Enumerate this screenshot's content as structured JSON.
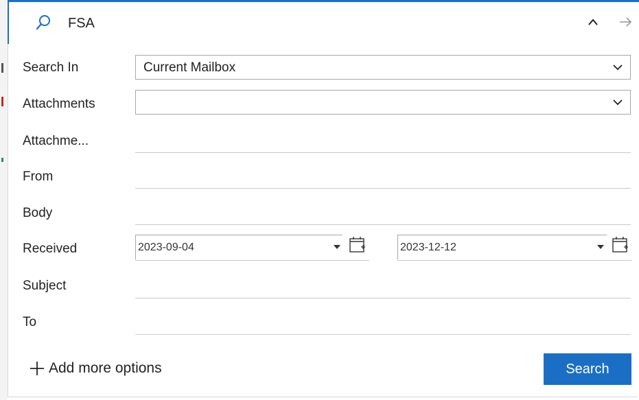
{
  "search": {
    "query": "FSA"
  },
  "fields": {
    "search_in": {
      "label": "Search In",
      "value": "Current Mailbox"
    },
    "attachments": {
      "label": "Attachments",
      "value": ""
    },
    "attachment_name": {
      "label": "Attachme...",
      "value": ""
    },
    "from": {
      "label": "From",
      "value": ""
    },
    "body": {
      "label": "Body",
      "value": ""
    },
    "received": {
      "label": "Received",
      "start": "2023-09-04",
      "end": "2023-12-12"
    },
    "subject": {
      "label": "Subject",
      "value": ""
    },
    "to": {
      "label": "To",
      "value": ""
    }
  },
  "footer": {
    "add_more": "Add more options",
    "search_button": "Search"
  },
  "colors": {
    "accent": "#1a6fc5",
    "edge_marks": [
      "#555555",
      "#c42b1c",
      "#2e8b57"
    ]
  },
  "icons": [
    "search-icon",
    "chevron-up-icon",
    "arrow-right-icon",
    "chevron-down-icon",
    "calendar-icon",
    "plus-icon"
  ]
}
